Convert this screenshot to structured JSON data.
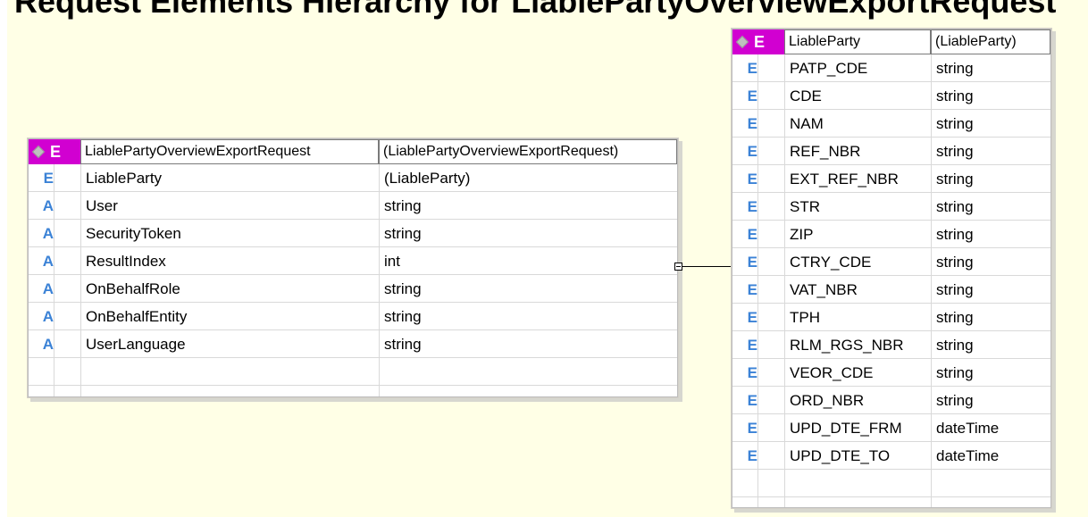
{
  "heading": "Request Elements Hierarchy for LiablePartyOverviewExportRequest",
  "left_box": {
    "name": "LiablePartyOverviewExportRequest",
    "type": "(LiablePartyOverviewExportRequest)",
    "kind": "E",
    "rows": [
      {
        "kind": "E",
        "name": "LiableParty",
        "type": "(LiableParty)"
      },
      {
        "kind": "A",
        "name": "User",
        "type": "string"
      },
      {
        "kind": "A",
        "name": "SecurityToken",
        "type": "string"
      },
      {
        "kind": "A",
        "name": "ResultIndex",
        "type": "int"
      },
      {
        "kind": "A",
        "name": "OnBehalfRole",
        "type": "string"
      },
      {
        "kind": "A",
        "name": "OnBehalfEntity",
        "type": "string"
      },
      {
        "kind": "A",
        "name": "UserLanguage",
        "type": "string"
      },
      {
        "kind": "",
        "name": "",
        "type": ""
      }
    ]
  },
  "right_box": {
    "name": "LiableParty",
    "type": "(LiableParty)",
    "kind": "E",
    "rows": [
      {
        "kind": "E",
        "name": "PATP_CDE",
        "type": "string"
      },
      {
        "kind": "E",
        "name": "CDE",
        "type": "string"
      },
      {
        "kind": "E",
        "name": "NAM",
        "type": "string"
      },
      {
        "kind": "E",
        "name": "REF_NBR",
        "type": "string"
      },
      {
        "kind": "E",
        "name": "EXT_REF_NBR",
        "type": "string"
      },
      {
        "kind": "E",
        "name": "STR",
        "type": "string"
      },
      {
        "kind": "E",
        "name": "ZIP",
        "type": "string"
      },
      {
        "kind": "E",
        "name": "CTRY_CDE",
        "type": "string"
      },
      {
        "kind": "E",
        "name": "VAT_NBR",
        "type": "string"
      },
      {
        "kind": "E",
        "name": "TPH",
        "type": "string"
      },
      {
        "kind": "E",
        "name": "RLM_RGS_NBR",
        "type": "string"
      },
      {
        "kind": "E",
        "name": "VEOR_CDE",
        "type": "string"
      },
      {
        "kind": "E",
        "name": "ORD_NBR",
        "type": "string"
      },
      {
        "kind": "E",
        "name": "UPD_DTE_FRM",
        "type": "dateTime"
      },
      {
        "kind": "E",
        "name": "UPD_DTE_TO",
        "type": "dateTime"
      },
      {
        "kind": "",
        "name": "",
        "type": ""
      }
    ]
  },
  "colors": {
    "header": "#d100d1",
    "background": "#ffffe6",
    "kind_icon": "#3b82d6"
  }
}
